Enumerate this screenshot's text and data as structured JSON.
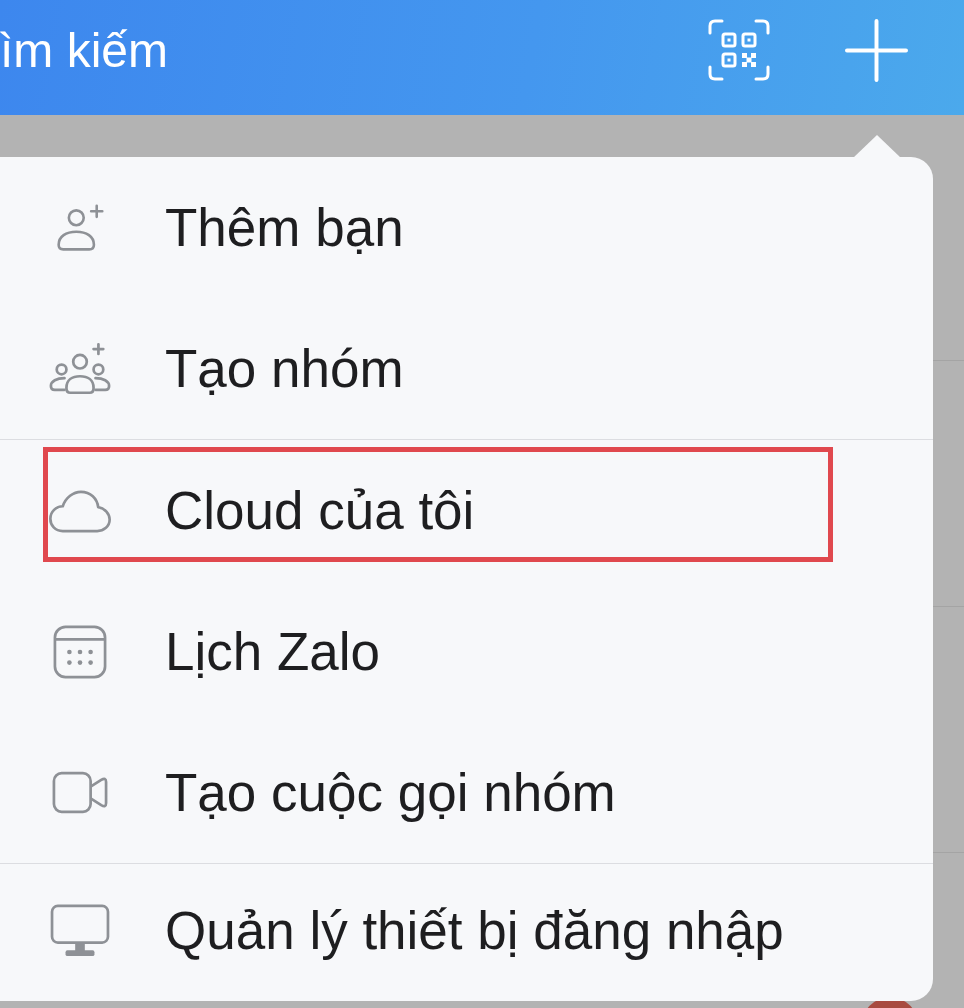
{
  "header": {
    "search": {
      "placeholder": "ìm kiếm"
    }
  },
  "menu": {
    "sections": [
      {
        "items": [
          {
            "kind": "add_friend",
            "label": "Thêm bạn",
            "highlighted": false
          },
          {
            "kind": "create_group",
            "label": "Tạo nhóm",
            "highlighted": false
          }
        ]
      },
      {
        "items": [
          {
            "kind": "cloud",
            "label": "Cloud của tôi",
            "highlighted": true
          },
          {
            "kind": "calendar",
            "label": "Lịch Zalo",
            "highlighted": false
          },
          {
            "kind": "group_call",
            "label": "Tạo cuộc gọi nhóm",
            "highlighted": false
          }
        ]
      },
      {
        "items": [
          {
            "kind": "devices",
            "label": "Quản lý thiết bị đăng nhập",
            "highlighted": false
          }
        ]
      }
    ]
  }
}
